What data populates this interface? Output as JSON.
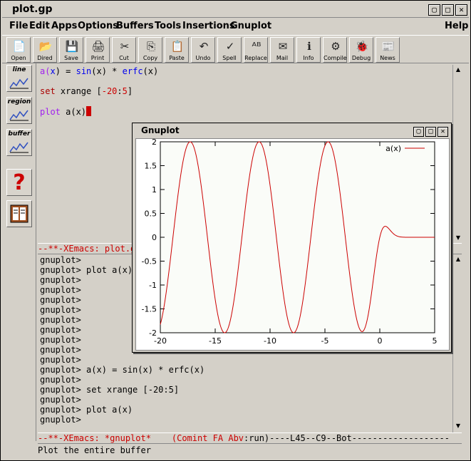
{
  "window": {
    "title": "plot.gp",
    "buttons": [
      "▢",
      "□",
      "✕"
    ]
  },
  "menu": [
    "File",
    "Edit",
    "Apps",
    "Options",
    "Buffers",
    "Tools",
    "Insertions",
    "Gnuplot",
    "Help"
  ],
  "toolbar": [
    {
      "label": "Open",
      "icon": "📄",
      "icon_name": "open-icon"
    },
    {
      "label": "Dired",
      "icon": "📂",
      "icon_name": "folder-icon"
    },
    {
      "label": "Save",
      "icon": "💾",
      "icon_name": "save-icon"
    },
    {
      "label": "Print",
      "icon": "🖨",
      "icon_name": "print-icon"
    },
    {
      "label": "Cut",
      "icon": "✂",
      "icon_name": "scissors-icon"
    },
    {
      "label": "Copy",
      "icon": "⎘",
      "icon_name": "copy-icon"
    },
    {
      "label": "Paste",
      "icon": "📋",
      "icon_name": "paste-icon"
    },
    {
      "label": "Undo",
      "icon": "↶",
      "icon_name": "undo-icon"
    },
    {
      "label": "Spell",
      "icon": "✓",
      "icon_name": "spell-icon"
    },
    {
      "label": "Replace",
      "icon": "ᴬᴮ",
      "icon_name": "replace-icon"
    },
    {
      "label": "Mail",
      "icon": "✉",
      "icon_name": "mail-icon"
    },
    {
      "label": "Info",
      "icon": "ℹ",
      "icon_name": "info-icon"
    },
    {
      "label": "Compile",
      "icon": "⚙",
      "icon_name": "compile-icon"
    },
    {
      "label": "Debug",
      "icon": "🐞",
      "icon_name": "debug-icon"
    },
    {
      "label": "News",
      "icon": "📰",
      "icon_name": "news-icon"
    }
  ],
  "sidebar": [
    {
      "label": "line",
      "icon_name": "plot-line-icon"
    },
    {
      "label": "region",
      "icon_name": "plot-region-icon"
    },
    {
      "label": "buffer",
      "icon_name": "plot-buffer-icon"
    }
  ],
  "editor": {
    "lines": [
      {
        "a": "a(",
        "b": "x",
        "c": ") = ",
        "d": "sin",
        "e": "(x) * ",
        "f": "erfc",
        "g": "(x)"
      },
      {
        "a": "set",
        "b": " xrange [",
        "c": "-20",
        "d": ":",
        "e": "5",
        "f": "]"
      },
      {
        "a": "plot",
        "b": " a(x)"
      }
    ]
  },
  "modeline_top": "--**-XEmacs: plot.gp",
  "repl": {
    "lines": [
      "gnuplot>",
      "gnuplot> plot a(x)",
      "gnuplot>",
      "gnuplot>",
      "gnuplot>",
      "gnuplot>",
      "gnuplot>",
      "gnuplot>",
      "gnuplot>",
      "gnuplot>",
      "gnuplot>",
      "gnuplot> a(x) = sin(x) * erfc(x)",
      "gnuplot>",
      "gnuplot> set xrange [-20:5]",
      "gnuplot>",
      "gnuplot> plot a(x)",
      "gnuplot>"
    ]
  },
  "modeline_bottom": {
    "prefix": "--**-XEmacs: *gnuplot*",
    "mode_open": "(",
    "mode": "Comint FA Abv",
    "mode_close": ":run)",
    "suffix": "----L45--C9--Bot-------------------"
  },
  "echo": "Plot the entire buffer",
  "gnuplot_window": {
    "title": "Gnuplot",
    "buttons": [
      "▢",
      "□",
      "✕"
    ]
  },
  "chart_data": {
    "type": "line",
    "title": "",
    "xlabel": "",
    "ylabel": "",
    "xlim": [
      -20,
      5
    ],
    "ylim": [
      -2,
      2
    ],
    "xticks": [
      "-20",
      "-15",
      "-10",
      "-5",
      "0",
      "5"
    ],
    "yticks": [
      "2",
      "1.5",
      "1",
      "0.5",
      "0",
      "-0.5",
      "-1",
      "-1.5",
      "-2"
    ],
    "series": [
      {
        "name": "a(x)",
        "color": "#cc0000",
        "function": "sin(x) * erfc(x)"
      }
    ],
    "legend_position": "top-right",
    "grid": false
  }
}
